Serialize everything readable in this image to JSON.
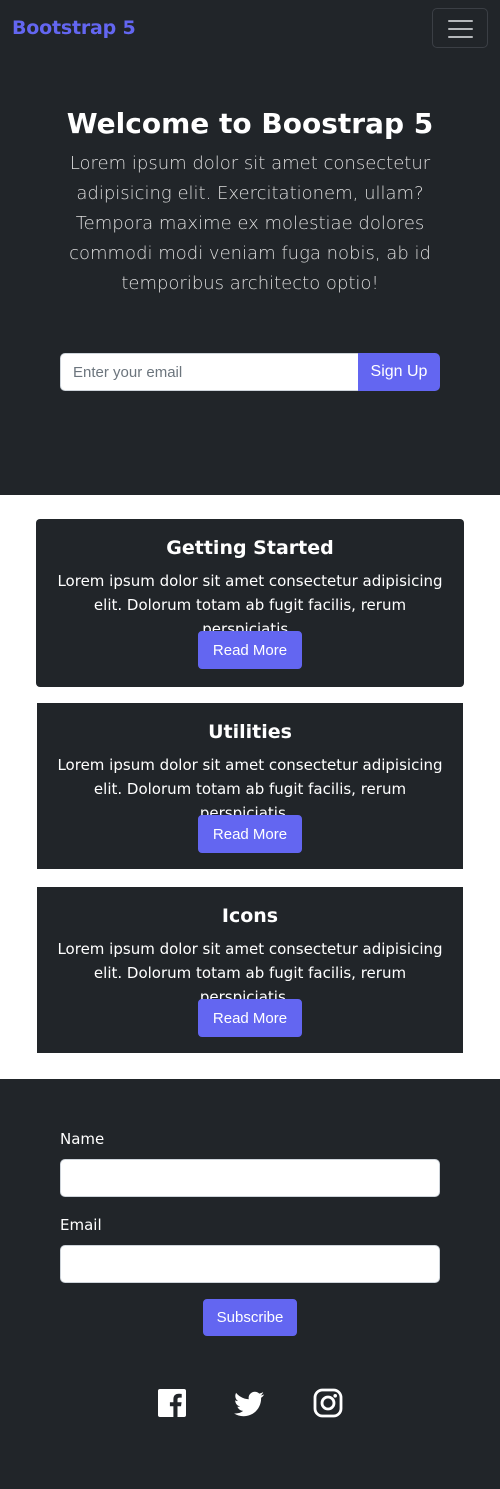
{
  "navbar": {
    "brand": "Bootstrap 5",
    "toggler_label": "Toggle navigation"
  },
  "hero": {
    "title": "Welcome to Boostrap 5",
    "text": "Lorem ipsum dolor sit amet consectetur adipisicing elit. Exercitationem, ullam? Tempora maxime ex molestiae dolores commodi modi veniam fuga nobis, ab id temporibus architecto optio!",
    "email_placeholder": "Enter your email",
    "signup_label": "Sign Up"
  },
  "cards": [
    {
      "title": "Getting Started",
      "text": "Lorem ipsum dolor sit amet consectetur adipisicing elit. Dolorum totam ab fugit facilis, rerum perspiciatis..",
      "button": "Read More"
    },
    {
      "title": "Utilities",
      "text": "Lorem ipsum dolor sit amet consectetur adipisicing elit. Dolorum totam ab fugit facilis, rerum perspiciatis...",
      "button": "Read More"
    },
    {
      "title": "Icons",
      "text": "Lorem ipsum dolor sit amet consectetur adipisicing elit. Dolorum totam ab fugit facilis, rerum perspiciatis...",
      "button": "Read More"
    }
  ],
  "subscribe_form": {
    "name_label": "Name",
    "name_value": "",
    "email_label": "Email",
    "email_value": "",
    "submit_label": "Subscribe"
  },
  "social": [
    {
      "icon": "facebook-icon"
    },
    {
      "icon": "twitter-icon"
    },
    {
      "icon": "instagram-icon"
    }
  ],
  "colors": {
    "background_dark": "#212529",
    "accent": "#6366f1",
    "cards_section_bg": "#ffffff"
  }
}
